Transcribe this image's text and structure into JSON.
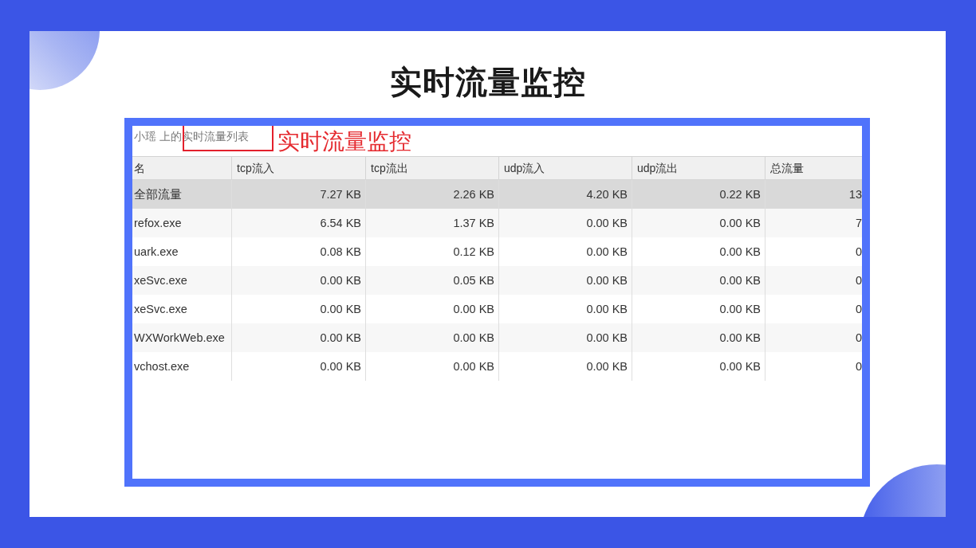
{
  "slide": {
    "title": "实时流量监控"
  },
  "screenshot": {
    "window_title": "小瑶 上的实时流量列表",
    "annotation": "实时流量监控",
    "table": {
      "columns": [
        "名",
        "tcp流入",
        "tcp流出",
        "udp流入",
        "udp流出",
        "总流量"
      ],
      "rows": [
        {
          "cells": [
            "全部流量",
            "7.27 KB",
            "2.26 KB",
            "4.20 KB",
            "0.22 KB",
            "13"
          ],
          "selected": true
        },
        {
          "cells": [
            "refox.exe",
            "6.54 KB",
            "1.37 KB",
            "0.00 KB",
            "0.00 KB",
            "7"
          ],
          "selected": false
        },
        {
          "cells": [
            "uark.exe",
            "0.08 KB",
            "0.12 KB",
            "0.00 KB",
            "0.00 KB",
            "0"
          ],
          "selected": false
        },
        {
          "cells": [
            "xeSvc.exe",
            "0.00 KB",
            "0.05 KB",
            "0.00 KB",
            "0.00 KB",
            "0"
          ],
          "selected": false
        },
        {
          "cells": [
            "xeSvc.exe",
            "0.00 KB",
            "0.00 KB",
            "0.00 KB",
            "0.00 KB",
            "0"
          ],
          "selected": false
        },
        {
          "cells": [
            "WXWorkWeb.exe",
            "0.00 KB",
            "0.00 KB",
            "0.00 KB",
            "0.00 KB",
            "0"
          ],
          "selected": false
        },
        {
          "cells": [
            "vchost.exe",
            "0.00 KB",
            "0.00 KB",
            "0.00 KB",
            "0.00 KB",
            "0"
          ],
          "selected": false
        }
      ]
    }
  }
}
